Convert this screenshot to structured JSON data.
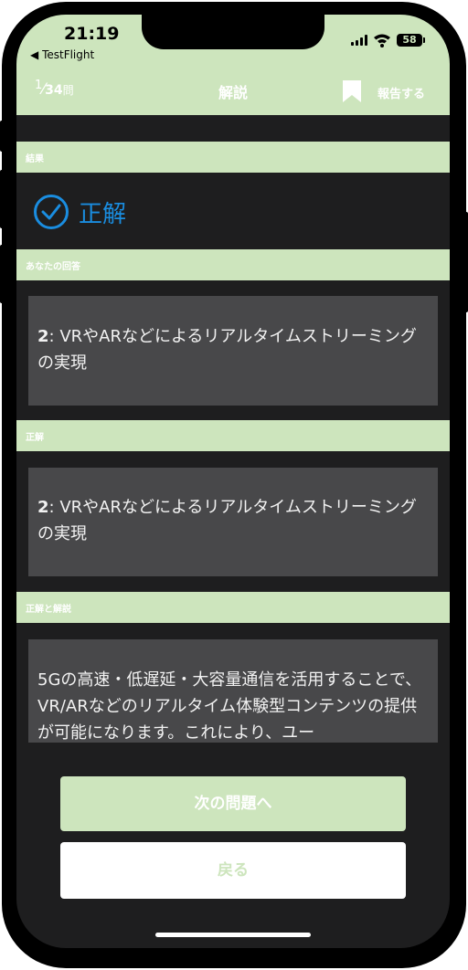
{
  "status_bar": {
    "time": "21:19",
    "back_app": "TestFlight",
    "battery": "58"
  },
  "header": {
    "progress_current": "1",
    "progress_total": "34",
    "progress_unit": "問",
    "title": "解説",
    "report_label": "報告する"
  },
  "sections": {
    "result_label": "結果",
    "your_answer_label": "あなたの回答",
    "correct_label": "正解",
    "explanation_label": "正解と解説"
  },
  "result": {
    "text": "正解",
    "color": "#1a8de0"
  },
  "your_answer": {
    "number": "2",
    "text": ": VRやARなどによるリアルタイムストリーミングの実現"
  },
  "correct_answer": {
    "number": "2",
    "text": ": VRやARなどによるリアルタイムストリーミングの実現"
  },
  "explanation": {
    "text": "5Gの高速・低遅延・大容量通信を活用することで、VR/ARなどのリアルタイム体験型コンテンツの提供が可能になります。これにより、ユー"
  },
  "buttons": {
    "next_label": "次の問題へ",
    "back_label": "戻る"
  },
  "colors": {
    "accent_green": "#cde5bd",
    "background": "#1e1e1f",
    "box": "#48484a",
    "correct_blue": "#1a8de0"
  }
}
